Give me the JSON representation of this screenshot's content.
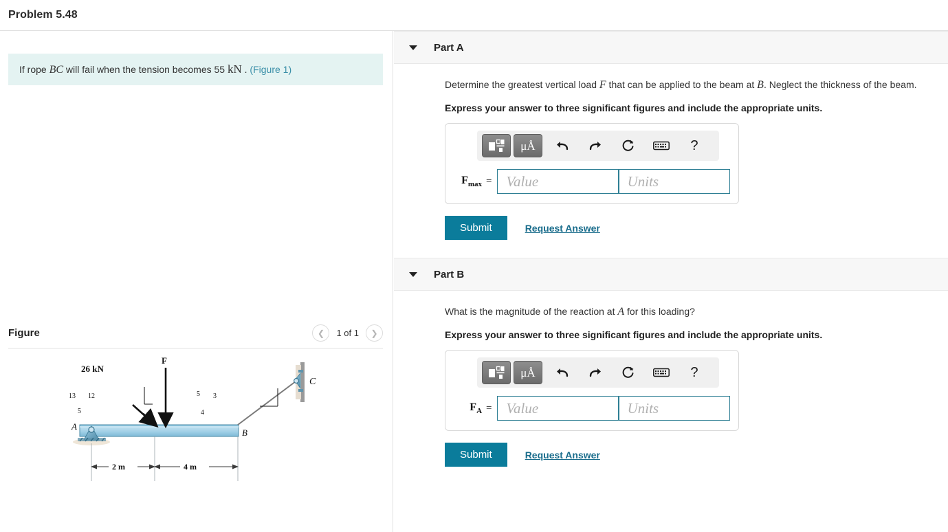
{
  "header": {
    "problem_title": "Problem 5.48"
  },
  "statement": {
    "prefix": "If rope ",
    "rope": "BC",
    "middle": " will fail when the tension becomes 55 ",
    "unit": "kN",
    "period": " . ",
    "figure_link": "(Figure 1)"
  },
  "figure": {
    "title": "Figure",
    "prev_icon": "chevron-left-icon",
    "next_icon": "chevron-right-icon",
    "count_label": "1 of 1",
    "diagram": {
      "load_label": "26 kN",
      "force_label": "F",
      "point_a": "A",
      "point_b": "B",
      "point_c": "C",
      "slope_left": {
        "hyp": "13",
        "vert": "12",
        "horiz": "5"
      },
      "slope_right": {
        "hyp": "5",
        "vert": "3",
        "horiz": "4"
      },
      "dim_left": "2 m",
      "dim_right": "4 m",
      "beam_color": "#a5d2e8",
      "beam_edge_color": "#4a90ad"
    }
  },
  "parts": [
    {
      "id": "part-a",
      "label": "Part A",
      "caret_icon": "caret-down-icon",
      "question_pre": "Determine the greatest vertical load ",
      "question_var1": "F",
      "question_mid": " that can be applied to the beam at ",
      "question_var2": "B",
      "question_post": ". Neglect the thickness of the beam.",
      "instruction": "Express your answer to three significant figures and include the appropriate units.",
      "toolbar": {
        "template_icon": "math-template-icon",
        "units_icon": "micro-angstrom-units-icon",
        "units_text": "μÅ",
        "undo_icon": "undo-icon",
        "redo_icon": "redo-icon",
        "reset_icon": "reset-icon",
        "keyboard_icon": "keyboard-icon",
        "help_icon": "help-icon",
        "help_text": "?"
      },
      "answer": {
        "var_main": "F",
        "var_sub": "max",
        "equals": "=",
        "value_placeholder": "Value",
        "units_placeholder": "Units",
        "value": "",
        "units": ""
      },
      "submit_label": "Submit",
      "request_label": "Request Answer"
    },
    {
      "id": "part-b",
      "label": "Part B",
      "caret_icon": "caret-down-icon",
      "question_pre": "What is the magnitude of the reaction at ",
      "question_var1": "A",
      "question_mid": " for this loading?",
      "question_var2": "",
      "question_post": "",
      "instruction": "Express your answer to three significant figures and include the appropriate units.",
      "toolbar": {
        "template_icon": "math-template-icon",
        "units_icon": "micro-angstrom-units-icon",
        "units_text": "μÅ",
        "undo_icon": "undo-icon",
        "redo_icon": "redo-icon",
        "reset_icon": "reset-icon",
        "keyboard_icon": "keyboard-icon",
        "help_icon": "help-icon",
        "help_text": "?"
      },
      "answer": {
        "var_main": "F",
        "var_sub": "A",
        "equals": "=",
        "value_placeholder": "Value",
        "units_placeholder": "Units",
        "value": "",
        "units": ""
      },
      "submit_label": "Submit",
      "request_label": "Request Answer"
    }
  ],
  "colors": {
    "accent": "#0b7c9b",
    "link": "#1a6d8c",
    "statement_bg": "#e4f3f2",
    "part_header_bg": "#f7f7f7",
    "field_border": "#2e7f94"
  }
}
